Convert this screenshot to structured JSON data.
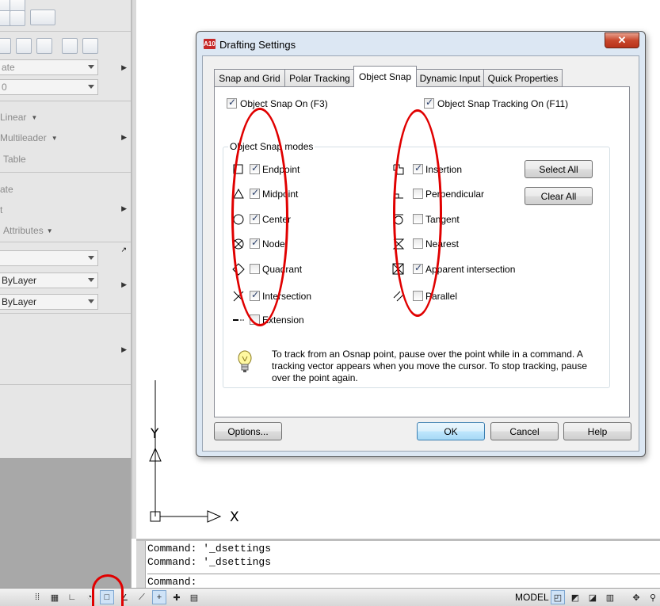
{
  "palette": {
    "items": [
      {
        "label": "ate"
      },
      {
        "label": "0"
      },
      {
        "label": "Linear"
      },
      {
        "label": "Multileader"
      },
      {
        "label": "Table"
      },
      {
        "label": "ate"
      },
      {
        "label": "t"
      },
      {
        "label": "Attributes"
      },
      {
        "label": "ByLayer"
      },
      {
        "label": "ByLayer"
      }
    ]
  },
  "dialog": {
    "title": "Drafting Settings",
    "close_label": "✕",
    "tabs": [
      {
        "label": "Snap and Grid",
        "active": false
      },
      {
        "label": "Polar Tracking",
        "active": false
      },
      {
        "label": "Object Snap",
        "active": true
      },
      {
        "label": "Dynamic Input",
        "active": false
      },
      {
        "label": "Quick Properties",
        "active": false
      }
    ],
    "object_snap_on": {
      "label": "Object Snap On (F3)",
      "checked": true
    },
    "object_snap_tracking_on": {
      "label": "Object Snap Tracking On (F11)",
      "checked": true
    },
    "group_title": "Object Snap modes",
    "modes_left": [
      {
        "label": "Endpoint",
        "checked": true,
        "icon": "endpoint-symbol-icon"
      },
      {
        "label": "Midpoint",
        "checked": true,
        "icon": "midpoint-symbol-icon"
      },
      {
        "label": "Center",
        "checked": true,
        "icon": "center-symbol-icon"
      },
      {
        "label": "Node",
        "checked": true,
        "icon": "node-symbol-icon"
      },
      {
        "label": "Quadrant",
        "checked": false,
        "icon": "quadrant-symbol-icon"
      },
      {
        "label": "Intersection",
        "checked": true,
        "icon": "intersection-symbol-icon"
      },
      {
        "label": "Extension",
        "checked": false,
        "icon": "extension-symbol-icon"
      }
    ],
    "modes_right": [
      {
        "label": "Insertion",
        "checked": true,
        "icon": "insertion-symbol-icon"
      },
      {
        "label": "Perpendicular",
        "checked": false,
        "icon": "perpendicular-symbol-icon"
      },
      {
        "label": "Tangent",
        "checked": false,
        "icon": "tangent-symbol-icon"
      },
      {
        "label": "Nearest",
        "checked": false,
        "icon": "nearest-symbol-icon"
      },
      {
        "label": "Apparent intersection",
        "checked": true,
        "icon": "apparent-intersection-symbol-icon"
      },
      {
        "label": "Parallel",
        "checked": false,
        "icon": "parallel-symbol-icon"
      }
    ],
    "select_all_label": "Select All",
    "clear_all_label": "Clear All",
    "tip": "To track from an Osnap point, pause over the point while in a command.  A tracking vector appears when you move the cursor.  To stop tracking, pause over the point again.",
    "options_label": "Options...",
    "ok_label": "OK",
    "cancel_label": "Cancel",
    "help_label": "Help"
  },
  "canvas": {
    "axis_y_label": "Y",
    "axis_x_label": "X"
  },
  "command_line": {
    "history": [
      "Command: '_dsettings",
      "Command: '_dsettings"
    ],
    "prompt": "Command:"
  },
  "status_bar": {
    "model_label": "MODEL"
  },
  "colors": {
    "annotation_red": "#e00000",
    "dialog_frame": "#dce7f3",
    "accent_blue": "#3c7fb1"
  }
}
